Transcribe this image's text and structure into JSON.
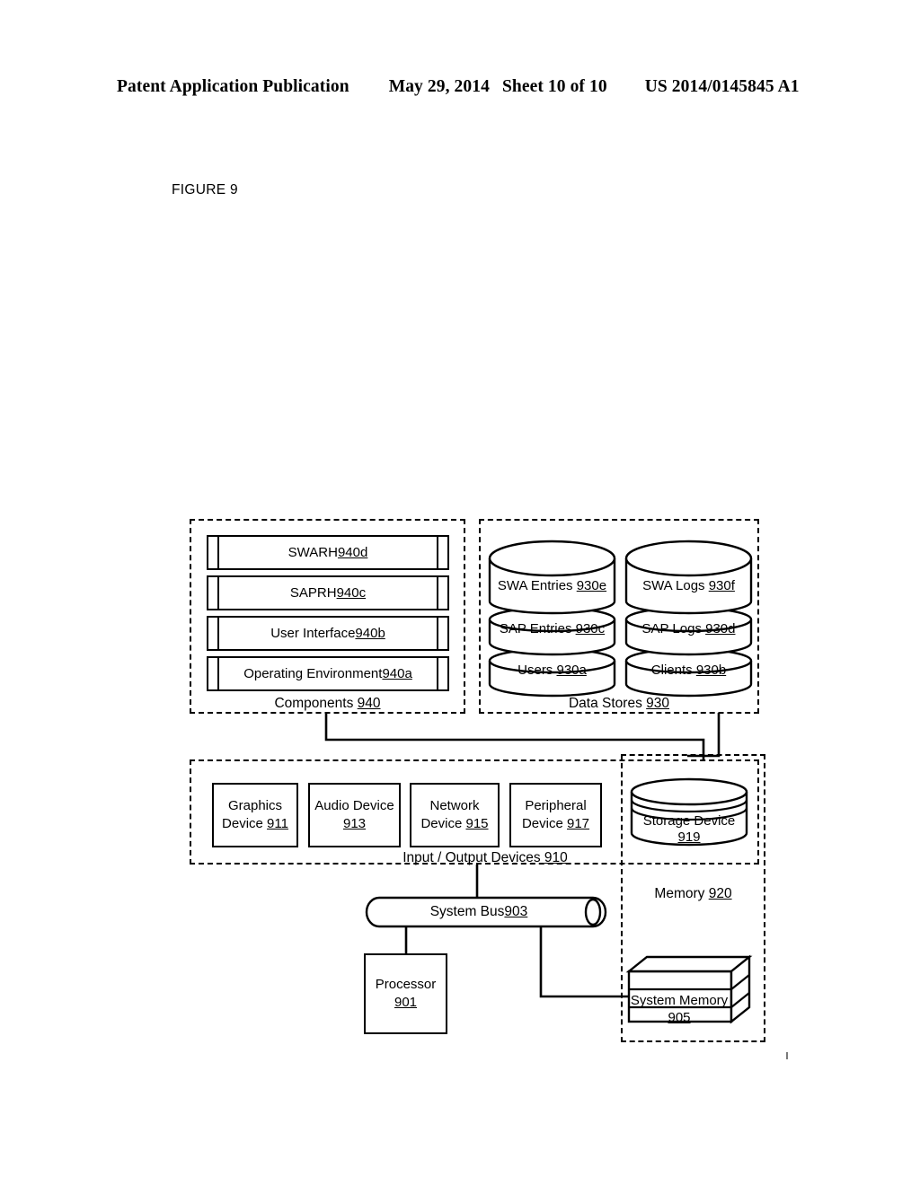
{
  "header": {
    "publication": "Patent Application Publication",
    "date": "May 29, 2014",
    "sheet": "Sheet 10 of 10",
    "document_number": "US 2014/0145845 A1"
  },
  "figure": {
    "label": "FIGURE 9"
  },
  "diagram": {
    "components_group": {
      "caption_text": "Components ",
      "caption_ref": "940",
      "items": [
        {
          "text": "SWARH ",
          "ref": "940d"
        },
        {
          "text": "SAPRH ",
          "ref": "940c"
        },
        {
          "text": "User Interface ",
          "ref": "940b"
        },
        {
          "text": "Operating Environment ",
          "ref": "940a"
        }
      ]
    },
    "data_stores_group": {
      "caption_text": "Data Stores ",
      "caption_ref": "930",
      "left_stack": [
        {
          "text": "SWA Entries ",
          "ref": "930e"
        },
        {
          "text": "SAP Entries ",
          "ref": "930c"
        },
        {
          "text": "Users ",
          "ref": "930a"
        }
      ],
      "right_stack": [
        {
          "text": "SWA Logs ",
          "ref": "930f"
        },
        {
          "text": "SAP Logs ",
          "ref": "930d"
        },
        {
          "text": "Clients ",
          "ref": "930b"
        }
      ]
    },
    "io_group": {
      "caption_text": "Input / Output Devices ",
      "caption_ref": "910",
      "devices": [
        {
          "line1": "Graphics",
          "line2_text": "Device ",
          "line2_ref": "911"
        },
        {
          "line1": "Audio Device",
          "line2_text": "",
          "line2_ref": "913"
        },
        {
          "line1": "Network",
          "line2_text": "Device ",
          "line2_ref": "915"
        },
        {
          "line1": "Peripheral",
          "line2_text": "Device ",
          "line2_ref": "917"
        }
      ]
    },
    "memory_group": {
      "caption_text": "Memory ",
      "caption_ref": "920",
      "storage_device": {
        "line1": "Storage Device",
        "ref": "919"
      },
      "system_memory": {
        "line1": "System Memory",
        "ref": "905"
      }
    },
    "system_bus": {
      "text": "System Bus ",
      "ref": "903"
    },
    "processor": {
      "line1": "Processor",
      "ref": "901"
    }
  },
  "colors": {
    "ink": "#000000",
    "page": "#ffffff"
  }
}
